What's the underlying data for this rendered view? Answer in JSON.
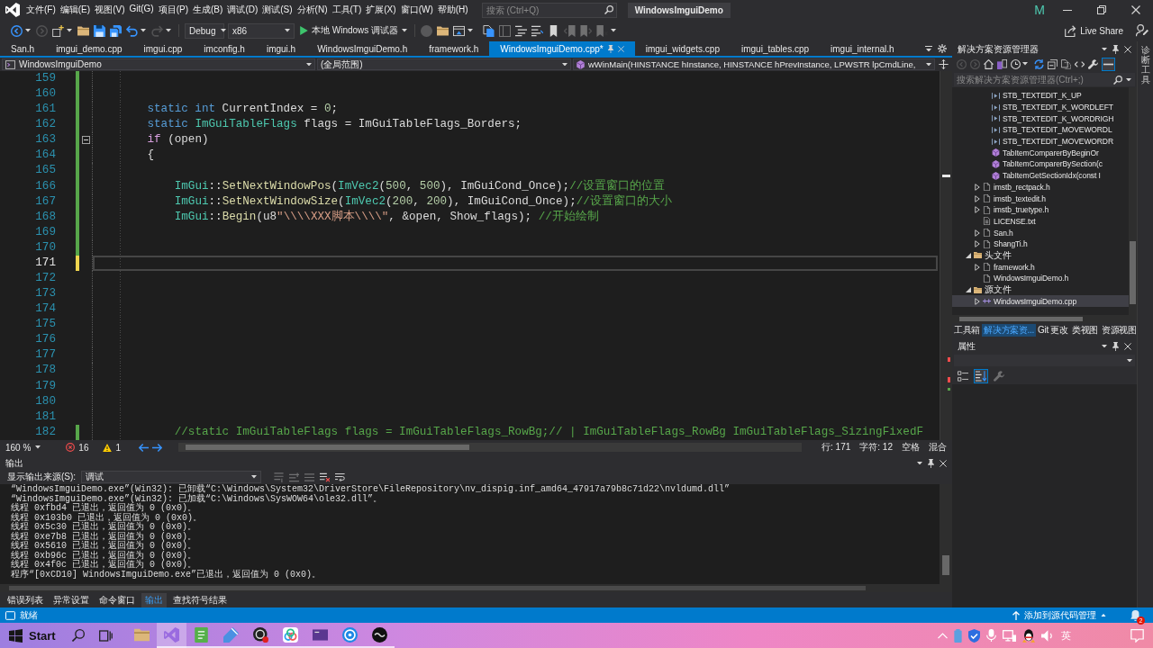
{
  "title_bar": {
    "menus": [
      "文件(F)",
      "编辑(E)",
      "视图(V)",
      "Git(G)",
      "项目(P)",
      "生成(B)",
      "调试(D)",
      "测试(S)",
      "分析(N)",
      "工具(T)",
      "扩展(X)",
      "窗口(W)",
      "帮助(H)"
    ],
    "search": {
      "placeholder": "搜索 (Ctrl+Q)"
    },
    "title": "WindowsImguiDemo",
    "account": "M"
  },
  "toolbar": {
    "buttons": [
      {
        "kind": "back",
        "disabled": false,
        "menu": true
      },
      {
        "kind": "forward",
        "disabled": true
      },
      {
        "kind": "new-item",
        "disabled": false,
        "menu": true
      },
      {
        "kind": "open",
        "disabled": false
      },
      {
        "kind": "save",
        "disabled": false
      },
      {
        "kind": "save-all",
        "disabled": false
      },
      {
        "kind": "undo",
        "disabled": false,
        "menu": true
      },
      {
        "kind": "redo",
        "disabled": true,
        "menu": true
      }
    ],
    "configuration": "Debug",
    "platform": "x86",
    "run": "本地 Windows 调试器",
    "tools": [
      {
        "kind": "record",
        "disabled": true
      },
      {
        "kind": "open",
        "disabled": false
      },
      {
        "kind": "browser",
        "disabled": false,
        "menu": true
      },
      {
        "kind": "files",
        "disabled": false
      },
      {
        "kind": "panel",
        "disabled": true
      },
      {
        "kind": "comment",
        "disabled": false
      },
      {
        "kind": "uncomment",
        "disabled": false
      },
      {
        "kind": "bookmark",
        "disabled": false
      },
      {
        "kind": "bookmark-prev",
        "disabled": true
      },
      {
        "kind": "bookmark-next",
        "disabled": true
      },
      {
        "kind": "bookmark-clear",
        "disabled": true,
        "menu": true
      }
    ],
    "live_share": "Live Share"
  },
  "editor": {
    "tabs": [
      {
        "label": "San.h",
        "selected": false
      },
      {
        "label": "imgui_demo.cpp",
        "selected": false
      },
      {
        "label": "imgui.cpp",
        "selected": false
      },
      {
        "label": "imconfig.h",
        "selected": false
      },
      {
        "label": "imgui.h",
        "selected": false
      },
      {
        "label": "WindowsImguiDemo.h",
        "selected": false
      },
      {
        "label": "framework.h",
        "selected": false
      },
      {
        "label": "WindowsImguiDemo.cpp*",
        "selected": true
      },
      {
        "label": "imgui_widgets.cpp",
        "selected": false
      },
      {
        "label": "imgui_tables.cpp",
        "selected": false
      },
      {
        "label": "imgui_internal.h",
        "selected": false
      }
    ],
    "nav": {
      "project": "WindowsImguiDemo",
      "scope": "(全局范围)",
      "member": "wWinMain(HINSTANCE hInstance, HINSTANCE hPrevInstance, LPWSTR lpCmdLine,"
    },
    "lines": [
      {
        "number": "159",
        "current": false,
        "saved": true
      },
      {
        "number": "160",
        "current": false,
        "saved": true
      },
      {
        "number": "161",
        "current": false,
        "saved": true,
        "tokens": [
          {
            "text": "        static int",
            "kind": "keyword"
          },
          {
            "text": " CurrentIndex = ",
            "kind": "plain"
          },
          {
            "text": "0",
            "kind": "number"
          },
          {
            "text": ";",
            "kind": "plain"
          }
        ]
      },
      {
        "number": "162",
        "current": false,
        "saved": true,
        "tokens": [
          {
            "text": "        static ",
            "kind": "keyword"
          },
          {
            "text": "ImGuiTableFlags",
            "kind": "type"
          },
          {
            "text": " flags = ImGuiTableFlags_Borders;",
            "kind": "plain"
          }
        ]
      },
      {
        "number": "163",
        "current": false,
        "saved": true,
        "expanded": true,
        "tokens": [
          {
            "text": "        if",
            "kind": "control"
          },
          {
            "text": " (open)",
            "kind": "plain"
          }
        ]
      },
      {
        "number": "164",
        "current": false,
        "saved": true,
        "tokens": [
          {
            "text": "        {",
            "kind": "plain"
          }
        ]
      },
      {
        "number": "165",
        "current": false,
        "saved": true
      },
      {
        "number": "166",
        "current": false,
        "saved": true,
        "tokens": [
          {
            "text": "            ImGui",
            "kind": "type"
          },
          {
            "text": "::",
            "kind": "plain"
          },
          {
            "text": "SetNextWindowPos",
            "kind": "function"
          },
          {
            "text": "(",
            "kind": "plain"
          },
          {
            "text": "ImVec2",
            "kind": "type"
          },
          {
            "text": "(",
            "kind": "plain"
          },
          {
            "text": "500",
            "kind": "number"
          },
          {
            "text": ", ",
            "kind": "plain"
          },
          {
            "text": "500",
            "kind": "number"
          },
          {
            "text": "), ImGuiCond_Once);",
            "kind": "plain"
          },
          {
            "text": "//设置窗口的位置",
            "kind": "comment"
          }
        ]
      },
      {
        "number": "167",
        "current": false,
        "saved": true,
        "tokens": [
          {
            "text": "            ImGui",
            "kind": "type"
          },
          {
            "text": "::",
            "kind": "plain"
          },
          {
            "text": "SetNextWindowSize",
            "kind": "function"
          },
          {
            "text": "(",
            "kind": "plain"
          },
          {
            "text": "ImVec2",
            "kind": "type"
          },
          {
            "text": "(",
            "kind": "plain"
          },
          {
            "text": "200",
            "kind": "number"
          },
          {
            "text": ", ",
            "kind": "plain"
          },
          {
            "text": "200",
            "kind": "number"
          },
          {
            "text": "), ImGuiCond_Once);",
            "kind": "plain"
          },
          {
            "text": "//设置窗口的大小",
            "kind": "comment"
          }
        ]
      },
      {
        "number": "168",
        "current": false,
        "saved": true,
        "tokens": [
          {
            "text": "            ImGui",
            "kind": "type"
          },
          {
            "text": "::",
            "kind": "plain"
          },
          {
            "text": "Begin",
            "kind": "function"
          },
          {
            "text": "(u8",
            "kind": "plain"
          },
          {
            "text": "\"\\\\\\\\XXX脚本\\\\\\\\\"",
            "kind": "string"
          },
          {
            "text": ", &open, Show_flags); ",
            "kind": "plain"
          },
          {
            "text": "//开始绘制",
            "kind": "comment"
          }
        ]
      },
      {
        "number": "169",
        "current": false,
        "saved": true
      },
      {
        "number": "170",
        "current": false,
        "saved": true
      },
      {
        "number": "171",
        "current": true,
        "saved": false
      },
      {
        "number": "172",
        "current": false
      },
      {
        "number": "173",
        "current": false
      },
      {
        "number": "174",
        "current": false
      },
      {
        "number": "175",
        "current": false
      },
      {
        "number": "176",
        "current": false
      },
      {
        "number": "177",
        "current": false
      },
      {
        "number": "178",
        "current": false
      },
      {
        "number": "179",
        "current": false
      },
      {
        "number": "180",
        "current": false
      },
      {
        "number": "181",
        "current": false
      },
      {
        "number": "182",
        "current": false,
        "saved": true,
        "tokens": [
          {
            "text": "            //static ImGuiTableFlags flags = ImGuiTableFlags_RowBg;// | ImGuiTableFlags_RowBg ImGuiTableFlags_SizingFixedF",
            "kind": "comment"
          }
        ]
      }
    ],
    "status": {
      "zoom": "160 %",
      "errors": "16",
      "warnings": "1",
      "line": "行: 171",
      "column": "字符: 12",
      "indentation": "空格",
      "line_ending": "混合"
    }
  },
  "output": {
    "title": "输出",
    "source_label": "显示输出来源(S):",
    "source": "调试",
    "tools": [
      {
        "kind": "prev",
        "disabled": true
      },
      {
        "kind": "next",
        "disabled": true
      },
      {
        "kind": "clear",
        "disabled": true
      },
      {
        "kind": "clear-all",
        "disabled": false
      },
      {
        "kind": "wrap",
        "disabled": false
      }
    ],
    "lines": [
      "“WindowsImguiDemo.exe”(Win32): 已卸载“C:\\Windows\\System32\\DriverStore\\FileRepository\\nv_dispig.inf_amd64_47917a79b8c71d22\\nvldumd.dll”",
      "“WindowsImguiDemo.exe”(Win32): 已加载“C:\\Windows\\SysWOW64\\ole32.dll”。",
      "线程 0xfbd4 已退出，返回值为 0 (0x0)。",
      "线程 0x103b0 已退出，返回值为 0 (0x0)。",
      "线程 0x5c30 已退出，返回值为 0 (0x0)。",
      "线程 0xe7b8 已退出，返回值为 0 (0x0)。",
      "线程 0x5610 已退出，返回值为 0 (0x0)。",
      "线程 0xb96c 已退出，返回值为 0 (0x0)。",
      "线程 0x4f0c 已退出，返回值为 0 (0x0)。",
      "程序“[0xCD10] WindowsImguiDemo.exe”已退出，返回值为 0 (0x0)。"
    ],
    "tabs": [
      {
        "label": "错误列表",
        "selected": false
      },
      {
        "label": "异常设置",
        "selected": false
      },
      {
        "label": "命令窗口",
        "selected": false
      },
      {
        "label": "输出",
        "selected": true
      },
      {
        "label": "查找符号结果",
        "selected": false
      }
    ]
  },
  "solution_explorer": {
    "title": "解决方案资源管理器",
    "tools": [
      {
        "kind": "back",
        "disabled": true
      },
      {
        "kind": "forward",
        "disabled": true
      },
      {
        "kind": "home",
        "disabled": false
      },
      {
        "kind": "views",
        "disabled": false
      },
      {
        "kind": "history",
        "disabled": false,
        "menu": true
      },
      {
        "kind": "sync",
        "disabled": false
      },
      {
        "kind": "collapse",
        "disabled": false
      },
      {
        "kind": "show-all",
        "disabled": false
      },
      {
        "kind": "code",
        "disabled": false
      },
      {
        "kind": "wrench",
        "disabled": false
      },
      {
        "kind": "preview",
        "disabled": false,
        "on": true
      }
    ],
    "search": {
      "placeholder": "搜索解决方案资源管理器(Ctrl+;)"
    },
    "tree": [
      {
        "children": [
          {
            "children": [
              {
                "label": "STB_TEXTEDIT_K_UP",
                "kind": "macro",
                "selected": false
              },
              {
                "label": "STB_TEXTEDIT_K_WORDLEFT",
                "kind": "macro",
                "selected": false
              },
              {
                "label": "STB_TEXTEDIT_K_WORDRIGH",
                "kind": "macro",
                "selected": false
              },
              {
                "label": "STB_TEXTEDIT_MOVEWORDL",
                "kind": "macro",
                "selected": false
              },
              {
                "label": "STB_TEXTEDIT_MOVEWORDR",
                "kind": "macro",
                "selected": false
              },
              {
                "label": "TabItemComparerByBeginOr",
                "kind": "function",
                "selected": false
              },
              {
                "label": "TabItemComparerBySection(c",
                "kind": "function",
                "selected": false
              },
              {
                "label": "TabItemGetSectionIdx(const I",
                "kind": "function",
                "selected": false
              }
            ]
          },
          {
            "label": "imstb_rectpack.h",
            "kind": "header",
            "expanded": false,
            "selected": false
          },
          {
            "label": "imstb_textedit.h",
            "kind": "header",
            "expanded": false,
            "selected": false
          },
          {
            "label": "imstb_truetype.h",
            "kind": "header",
            "expanded": false,
            "selected": false
          },
          {
            "label": "LICENSE.txt",
            "kind": "text",
            "selected": false
          },
          {
            "label": "San.h",
            "kind": "header",
            "expanded": false,
            "selected": false
          },
          {
            "label": "ShangTi.h",
            "kind": "header",
            "expanded": false,
            "selected": false
          }
        ]
      },
      {
        "label": "头文件",
        "kind": "folder",
        "expanded": true,
        "selected": false,
        "children": [
          {
            "label": "framework.h",
            "kind": "header",
            "expanded": false,
            "selected": false
          },
          {
            "label": "WindowsImguiDemo.h",
            "kind": "header",
            "selected": false
          }
        ]
      },
      {
        "label": "源文件",
        "kind": "folder",
        "expanded": true,
        "selected": false,
        "children": [
          {
            "label": "WindowsImguiDemo.cpp",
            "kind": "source",
            "expanded": false,
            "selected": true
          }
        ]
      }
    ],
    "tabs": [
      {
        "label": "工具箱",
        "selected": false
      },
      {
        "label": "解决方案资...",
        "selected": true
      },
      {
        "label": "Git 更改",
        "selected": false
      },
      {
        "label": "类视图",
        "selected": false
      },
      {
        "label": "资源视图",
        "selected": false
      }
    ]
  },
  "properties": {
    "title": "属性",
    "tools": [
      {
        "kind": "categorized",
        "disabled": false
      },
      {
        "kind": "alphabetical",
        "disabled": false,
        "on": true
      },
      {
        "kind": "wrench",
        "disabled": true
      }
    ]
  },
  "side_tabs": [
    {
      "label": "诊断工具"
    }
  ],
  "status_bar": {
    "text": "就绪",
    "source_control": "添加到源代码管理",
    "notifications": "2"
  },
  "taskbar": {
    "start": "Start",
    "apps": [
      {
        "kind": "folder",
        "active": false,
        "running": false
      },
      {
        "kind": "ide",
        "active": true,
        "running": true
      },
      {
        "kind": "notepad",
        "active": false,
        "running": true
      },
      {
        "kind": "pen",
        "active": false,
        "running": true
      },
      {
        "kind": "recorder",
        "active": false,
        "running": true
      },
      {
        "kind": "rings",
        "active": false,
        "running": true
      },
      {
        "kind": "media",
        "active": false,
        "running": true
      },
      {
        "kind": "round",
        "active": false,
        "running": true
      },
      {
        "kind": "disc",
        "active": false,
        "running": true
      }
    ],
    "language": "英"
  }
}
